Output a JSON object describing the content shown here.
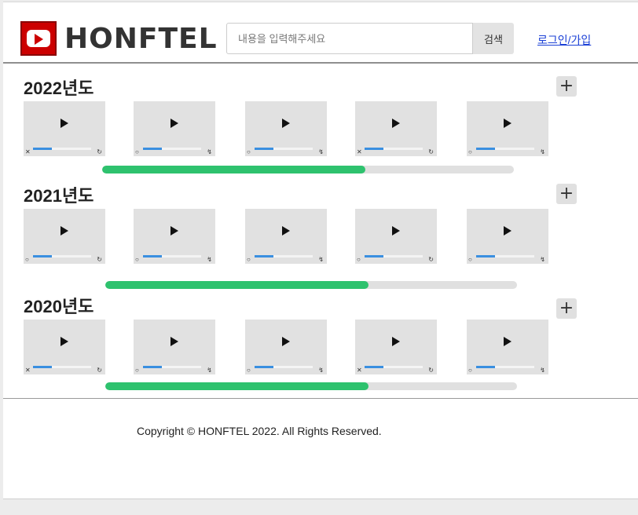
{
  "brand": {
    "name": "HONFTEL",
    "logo_color": "#cc0000"
  },
  "search": {
    "placeholder": "내용을 입력해주세요",
    "button_label": "검색"
  },
  "auth": {
    "login_label": "로그인/가입"
  },
  "sections": [
    {
      "title": "2022년도",
      "add_label": "+",
      "progress_fraction": 0.64,
      "videos": [
        {
          "icon": "play-icon",
          "left_ctrl": "✕",
          "right_ctrl": "↻"
        },
        {
          "icon": "play-icon",
          "left_ctrl": "○",
          "right_ctrl": "↯"
        },
        {
          "icon": "play-icon",
          "left_ctrl": "○",
          "right_ctrl": "↯"
        },
        {
          "icon": "play-icon",
          "left_ctrl": "✕",
          "right_ctrl": "↻"
        },
        {
          "icon": "play-icon",
          "left_ctrl": "○",
          "right_ctrl": "↯"
        }
      ]
    },
    {
      "title": "2021년도",
      "add_label": "+",
      "progress_fraction": 0.64,
      "videos": [
        {
          "icon": "play-icon",
          "left_ctrl": "○",
          "right_ctrl": "↻"
        },
        {
          "icon": "play-icon",
          "left_ctrl": "○",
          "right_ctrl": "↯"
        },
        {
          "icon": "play-icon",
          "left_ctrl": "○",
          "right_ctrl": "↯"
        },
        {
          "icon": "play-icon",
          "left_ctrl": "○",
          "right_ctrl": "↻"
        },
        {
          "icon": "play-icon",
          "left_ctrl": "○",
          "right_ctrl": "↯"
        }
      ]
    },
    {
      "title": "2020년도",
      "add_label": "+",
      "progress_fraction": 0.64,
      "videos": [
        {
          "icon": "play-icon",
          "left_ctrl": "✕",
          "right_ctrl": "↻"
        },
        {
          "icon": "play-icon",
          "left_ctrl": "○",
          "right_ctrl": "↯"
        },
        {
          "icon": "play-icon",
          "left_ctrl": "○",
          "right_ctrl": "↯"
        },
        {
          "icon": "play-icon",
          "left_ctrl": "✕",
          "right_ctrl": "↻"
        },
        {
          "icon": "play-icon",
          "left_ctrl": "○",
          "right_ctrl": "↯"
        }
      ]
    }
  ],
  "colors": {
    "progress_fill": "#2ec26e",
    "video_scrub": "#3a8fe0",
    "link": "#1a3fd6"
  },
  "footer": {
    "copyright": "Copyright © HONFTEL 2022. All Rights Reserved."
  }
}
